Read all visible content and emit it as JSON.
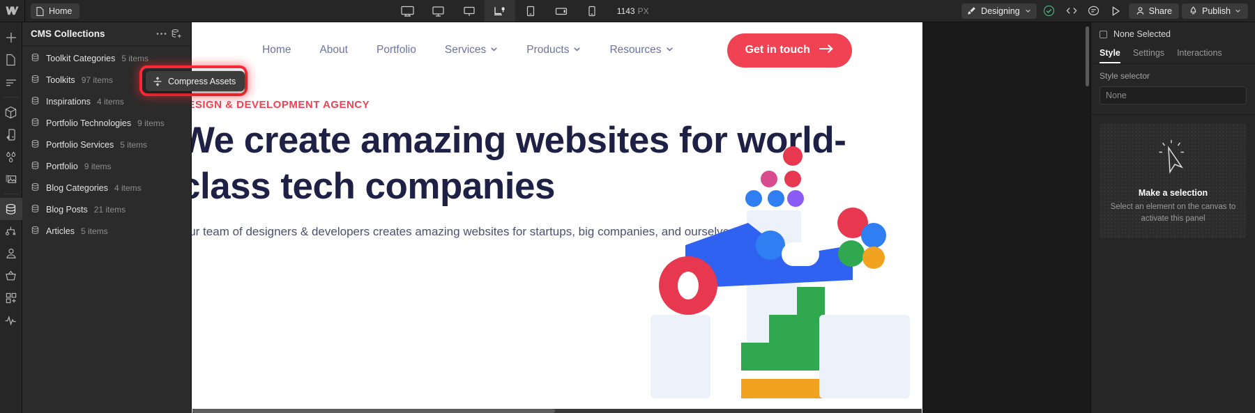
{
  "topbar": {
    "logo_icon": "webflow-logo-icon",
    "page_tab": {
      "label": "Home",
      "icon": "page-icon"
    },
    "breakpoints": [
      {
        "name": "desktop-xl",
        "icon": "monitor-large-icon",
        "active": false
      },
      {
        "name": "desktop-large",
        "icon": "monitor-medium-icon",
        "active": false
      },
      {
        "name": "desktop",
        "icon": "monitor-small-icon",
        "active": false
      },
      {
        "name": "base-breakpoint",
        "icon": "base-breakpoint-icon",
        "active": true
      },
      {
        "name": "tablet",
        "icon": "tablet-icon",
        "active": false
      },
      {
        "name": "mobile-landscape",
        "icon": "mobile-landscape-icon",
        "active": false
      },
      {
        "name": "mobile-portrait",
        "icon": "mobile-portrait-icon",
        "active": false
      }
    ],
    "viewport_width": "1143",
    "viewport_unit": "PX",
    "mode": {
      "label": "Designing",
      "icon": "brush-icon",
      "chevron": "chevron-down-icon"
    },
    "actions": [
      {
        "name": "audit-check",
        "icon": "check-circle-icon"
      },
      {
        "name": "custom-code",
        "icon": "code-icon"
      },
      {
        "name": "comments",
        "icon": "comment-icon"
      },
      {
        "name": "preview",
        "icon": "play-icon"
      }
    ],
    "share": {
      "label": "Share",
      "icon": "person-icon"
    },
    "publish": {
      "label": "Publish",
      "icon": "rocket-icon",
      "chevron": "chevron-down-icon"
    }
  },
  "rail": {
    "items": [
      {
        "name": "add-elements",
        "icon": "plus-icon",
        "active": false
      },
      {
        "name": "pages",
        "icon": "page-icon",
        "active": false
      },
      {
        "name": "navigator",
        "icon": "navigator-icon",
        "active": false
      },
      {
        "name": "components",
        "icon": "cube-icon",
        "active": false
      },
      {
        "name": "style-manager",
        "icon": "paint-icon",
        "active": false
      },
      {
        "name": "variables",
        "icon": "drops-icon",
        "active": false
      },
      {
        "name": "assets",
        "icon": "image-icon",
        "active": false
      },
      {
        "name": "cms-collections",
        "icon": "database-icon",
        "active": true
      },
      {
        "name": "logic",
        "icon": "logic-icon",
        "active": false
      },
      {
        "name": "users",
        "icon": "user-icon",
        "active": false
      },
      {
        "name": "ecommerce",
        "icon": "basket-icon",
        "active": false
      },
      {
        "name": "apps",
        "icon": "apps-grid-icon",
        "active": false
      },
      {
        "name": "audit",
        "icon": "pulse-icon",
        "active": false
      }
    ]
  },
  "cms_panel": {
    "title": "CMS Collections",
    "more_icon": "ellipsis-icon",
    "add_collection_icon": "add-collection-icon",
    "collections": [
      {
        "name": "Toolkit Categories",
        "count": "5 items"
      },
      {
        "name": "Toolkits",
        "count": "97 items"
      },
      {
        "name": "Inspirations",
        "count": "4 items"
      },
      {
        "name": "Portfolio Technologies",
        "count": "9 items"
      },
      {
        "name": "Portfolio Services",
        "count": "5 items"
      },
      {
        "name": "Portfolio",
        "count": "9 items"
      },
      {
        "name": "Blog Categories",
        "count": "4 items"
      },
      {
        "name": "Blog Posts",
        "count": "21 items"
      },
      {
        "name": "Articles",
        "count": "5 items"
      }
    ]
  },
  "tooltip": {
    "label": "Compress Assets",
    "icon": "compress-icon",
    "highlight_color": "#ff2a35"
  },
  "canvas": {
    "nav": [
      {
        "label": "Home",
        "has_dropdown": false
      },
      {
        "label": "About",
        "has_dropdown": false
      },
      {
        "label": "Portfolio",
        "has_dropdown": false
      },
      {
        "label": "Services",
        "has_dropdown": true
      },
      {
        "label": "Products",
        "has_dropdown": true
      },
      {
        "label": "Resources",
        "has_dropdown": true
      }
    ],
    "cta": {
      "label": "Get in touch",
      "icon": "arrow-right-icon",
      "color": "#f04253"
    },
    "hero": {
      "eyebrow": "DESIGN & DEVELOPMENT AGENCY",
      "heading": "We create amazing websites for world-class tech companies",
      "paragraph": "Our team of designers & developers creates amazing websites for startups, big companies, and ourselves.",
      "heading_color": "#1e2145",
      "accent_color": "#f04253"
    }
  },
  "right_panel": {
    "selection": {
      "label": "None Selected",
      "checkbox_icon": "checkbox-icon"
    },
    "tabs": [
      {
        "label": "Style",
        "active": true
      },
      {
        "label": "Settings",
        "active": false
      },
      {
        "label": "Interactions",
        "active": false
      }
    ],
    "style_selector": {
      "label": "Style selector",
      "value": "None"
    },
    "empty_state": {
      "icon": "click-cursor-icon",
      "title": "Make a selection",
      "subtitle": "Select an element on the canvas to activate this panel"
    }
  }
}
